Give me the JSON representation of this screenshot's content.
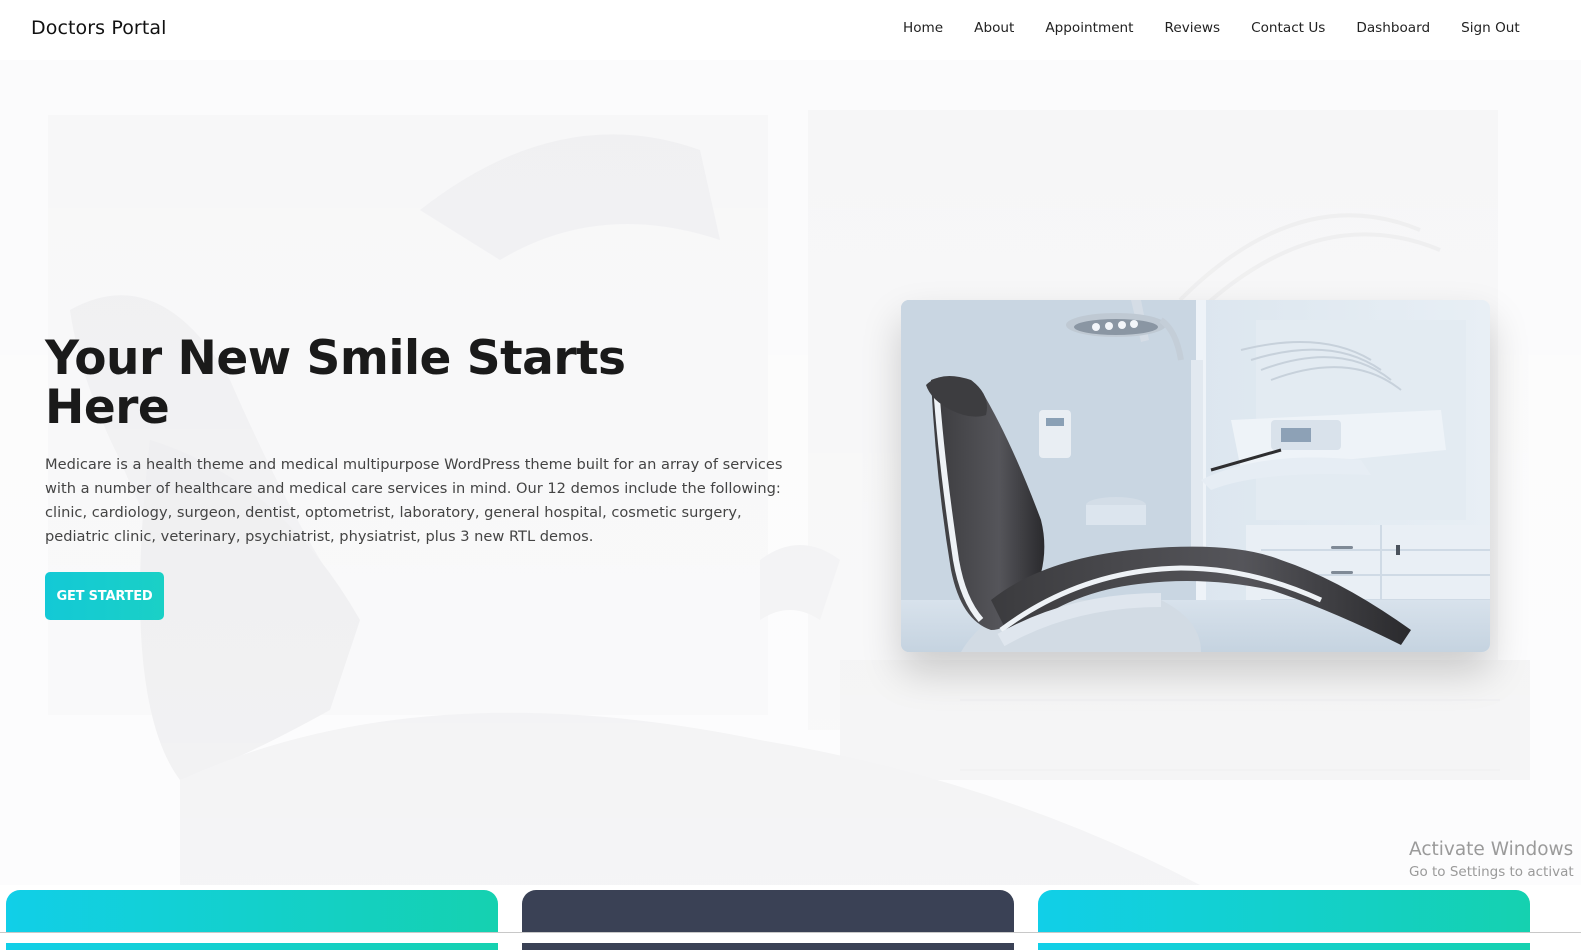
{
  "brand": {
    "name": "Doctors Portal"
  },
  "nav": {
    "items": [
      {
        "label": "Home"
      },
      {
        "label": "About"
      },
      {
        "label": "Appointment"
      },
      {
        "label": "Reviews"
      },
      {
        "label": "Contact Us"
      },
      {
        "label": "Dashboard"
      },
      {
        "label": "Sign Out"
      }
    ]
  },
  "hero": {
    "title": "Your New Smile Starts Here",
    "description": "Medicare is a health theme and medical multipurpose WordPress theme built for an array of services with a number of healthcare and medical care services in mind. Our 12 demos include the following: clinic, cardiology, surgeon, dentist, optometrist, laboratory, general hospital, cosmetic surgery, pediatric clinic, veterinary, psychiatrist, physiatrist, plus 3 new RTL demos.",
    "cta_label": "GET STARTED",
    "image": "dental-chair-photo"
  },
  "watermark": {
    "title": "Activate Windows",
    "subtitle": "Go to Settings to activat"
  },
  "colors": {
    "accent_start": "#13c9d6",
    "accent_end": "#15d1b0",
    "dark_card": "#3a4155",
    "text_dark": "#1a1a1a",
    "text_body": "#444444"
  }
}
